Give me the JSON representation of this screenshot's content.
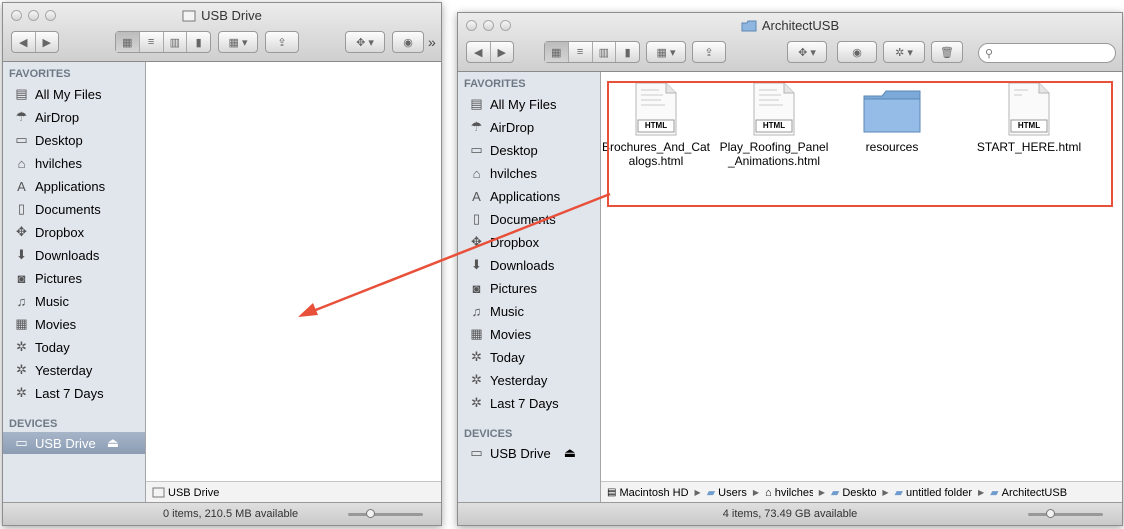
{
  "colors": {
    "highlight": "#e8503a",
    "sidebar": "#e1e6ed",
    "folder": "#7da9d8"
  },
  "left_window": {
    "title": "USB Drive",
    "sidebar": {
      "favorites_header": "FAVORITES",
      "favorites": [
        {
          "label": "All My Files",
          "icon": "all-files-icon"
        },
        {
          "label": "AirDrop",
          "icon": "airdrop-icon"
        },
        {
          "label": "Desktop",
          "icon": "desktop-icon"
        },
        {
          "label": "hvilches",
          "icon": "home-icon"
        },
        {
          "label": "Applications",
          "icon": "applications-icon"
        },
        {
          "label": "Documents",
          "icon": "documents-icon"
        },
        {
          "label": "Dropbox",
          "icon": "dropbox-icon"
        },
        {
          "label": "Downloads",
          "icon": "downloads-icon"
        },
        {
          "label": "Pictures",
          "icon": "pictures-icon"
        },
        {
          "label": "Music",
          "icon": "music-icon"
        },
        {
          "label": "Movies",
          "icon": "movies-icon"
        },
        {
          "label": "Today",
          "icon": "gear-icon"
        },
        {
          "label": "Yesterday",
          "icon": "gear-icon"
        },
        {
          "label": "Last 7 Days",
          "icon": "gear-icon"
        }
      ],
      "devices_header": "DEVICES",
      "devices": [
        {
          "label": "USB Drive",
          "icon": "drive-icon",
          "eject": "⏏"
        }
      ]
    },
    "pathbar": "USB Drive",
    "status": "0 items, 210.5 MB available"
  },
  "right_window": {
    "title": "ArchitectUSB",
    "sidebar": {
      "favorites_header": "FAVORITES",
      "favorites": [
        {
          "label": "All My Files",
          "icon": "all-files-icon"
        },
        {
          "label": "AirDrop",
          "icon": "airdrop-icon"
        },
        {
          "label": "Desktop",
          "icon": "desktop-icon"
        },
        {
          "label": "hvilches",
          "icon": "home-icon"
        },
        {
          "label": "Applications",
          "icon": "applications-icon"
        },
        {
          "label": "Documents",
          "icon": "documents-icon"
        },
        {
          "label": "Dropbox",
          "icon": "dropbox-icon"
        },
        {
          "label": "Downloads",
          "icon": "downloads-icon"
        },
        {
          "label": "Pictures",
          "icon": "pictures-icon"
        },
        {
          "label": "Music",
          "icon": "music-icon"
        },
        {
          "label": "Movies",
          "icon": "movies-icon"
        },
        {
          "label": "Today",
          "icon": "gear-icon"
        },
        {
          "label": "Yesterday",
          "icon": "gear-icon"
        },
        {
          "label": "Last 7 Days",
          "icon": "gear-icon"
        }
      ],
      "devices_header": "DEVICES",
      "devices": [
        {
          "label": "USB Drive",
          "icon": "drive-icon",
          "eject": "⏏"
        }
      ]
    },
    "files": [
      {
        "name": "Brochures_And_Cat alogs.html",
        "line1": "Brochures_And_Cat",
        "line2": "alogs.html",
        "type": "html",
        "badge": "HTML"
      },
      {
        "name": "Play_Roofing_Panel _Animations.html",
        "line1": "Play_Roofing_Panel",
        "line2": "_Animations.html",
        "type": "html",
        "badge": "HTML"
      },
      {
        "name": "resources",
        "line1": "resources",
        "line2": "",
        "type": "folder",
        "badge": ""
      },
      {
        "name": "START_HERE.html",
        "line1": "START_HERE.html",
        "line2": "",
        "type": "html",
        "badge": "HTML"
      }
    ],
    "pathbar": [
      "Macintosh HD",
      "Users",
      "hvilches",
      "Desktop",
      "untitled folder",
      "ArchitectUSB"
    ],
    "status": "4 items, 73.49 GB available"
  }
}
